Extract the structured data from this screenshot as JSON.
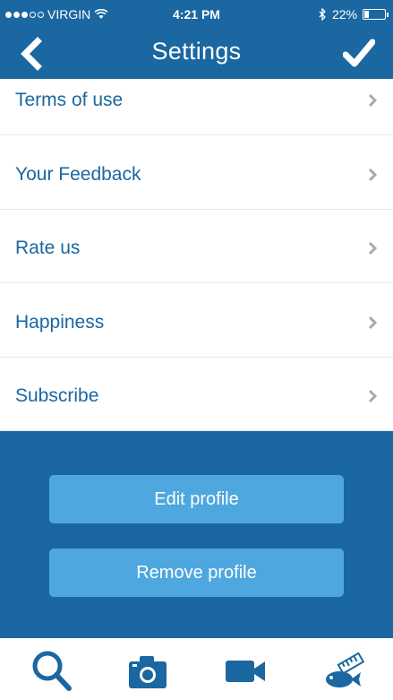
{
  "status_bar": {
    "carrier": "VIRGIN",
    "time": "4:21 PM",
    "battery": "22%"
  },
  "nav": {
    "title": "Settings"
  },
  "settings_items": [
    {
      "label": "Terms of use"
    },
    {
      "label": "Your Feedback"
    },
    {
      "label": "Rate us"
    },
    {
      "label": "Happiness"
    },
    {
      "label": "Subscribe"
    }
  ],
  "profile_actions": {
    "edit_label": "Edit profile",
    "remove_label": "Remove profile"
  },
  "tab_bar": {
    "tabs": [
      {
        "icon": "search-icon"
      },
      {
        "icon": "camera-icon"
      },
      {
        "icon": "video-camera-icon"
      },
      {
        "icon": "fish-ruler-icon"
      }
    ]
  },
  "colors": {
    "primary": "#1a67a1",
    "button": "#4ea7df",
    "chevron": "#a9a9a9",
    "divider": "#e3e6ea"
  }
}
